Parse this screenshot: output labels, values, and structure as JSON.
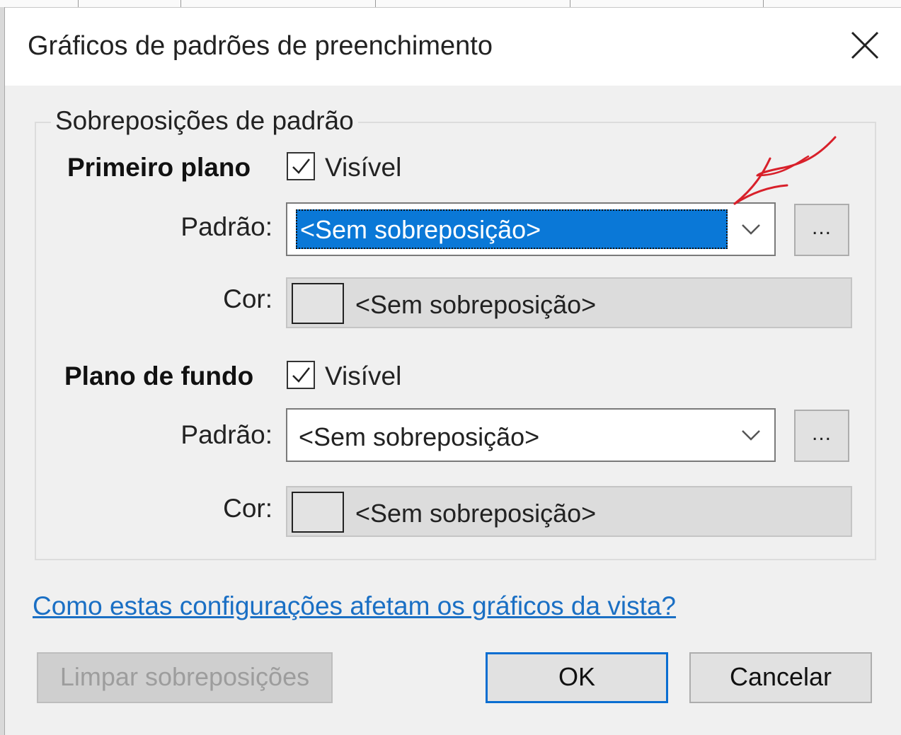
{
  "dialog": {
    "title": "Gráficos de padrões de preenchimento"
  },
  "group": {
    "legend": "Sobreposições de padrão"
  },
  "foreground": {
    "section_label": "Primeiro plano",
    "visible_label": "Visível",
    "visible_checked": true,
    "pattern_label": "Padrão:",
    "pattern_value": "<Sem sobreposição>",
    "pattern_selected": true,
    "pattern_more_label": "...",
    "color_label": "Cor:",
    "color_value": "<Sem sobreposição>"
  },
  "background": {
    "section_label": "Plano de fundo",
    "visible_label": "Visível",
    "visible_checked": true,
    "pattern_label": "Padrão:",
    "pattern_value": "<Sem sobreposição>",
    "pattern_more_label": "...",
    "color_label": "Cor:",
    "color_value": "<Sem sobreposição>"
  },
  "help_link": "Como estas configurações afetam os gráficos da vista?",
  "buttons": {
    "clear": "Limpar sobreposições",
    "ok": "OK",
    "cancel": "Cancelar"
  },
  "colors": {
    "selection": "#0a78d7",
    "link": "#1a6fc4",
    "annotation": "#d8202a"
  },
  "icons": {
    "close": "close-icon",
    "checkbox": "checkmark-icon",
    "dropdown": "chevron-down-icon",
    "annotation": "arrow-annotation-icon"
  }
}
